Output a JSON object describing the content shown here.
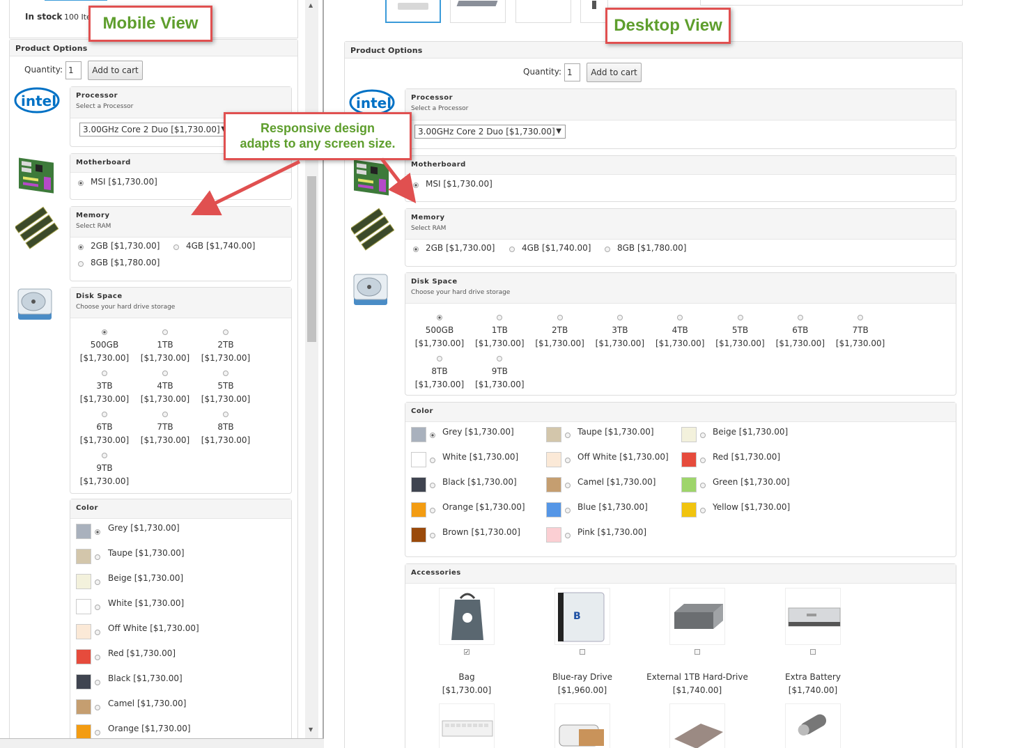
{
  "mobile": {
    "stock_label": "In stock",
    "stock_value": "100 Ite",
    "panel_title": "Product Options",
    "quantity_label": "Quantity:",
    "quantity_value": "1",
    "add_to_cart": "Add to cart",
    "processor": {
      "title": "Processor",
      "subtitle": "Select a Processor",
      "selected": "3.00GHz Core 2 Duo  [$1,730.00]"
    },
    "motherboard": {
      "title": "Motherboard",
      "option": "MSI  [$1,730.00]"
    },
    "memory": {
      "title": "Memory",
      "subtitle": "Select RAM",
      "options": [
        "2GB  [$1,730.00]",
        "4GB  [$1,740.00]",
        "8GB  [$1,780.00]"
      ]
    },
    "disk": {
      "title": "Disk Space",
      "subtitle": "Choose your hard drive storage",
      "options": [
        {
          "size": "500GB",
          "price": "[$1,730.00]"
        },
        {
          "size": "1TB",
          "price": "[$1,730.00]"
        },
        {
          "size": "2TB",
          "price": "[$1,730.00]"
        },
        {
          "size": "3TB",
          "price": "[$1,730.00]"
        },
        {
          "size": "4TB",
          "price": "[$1,730.00]"
        },
        {
          "size": "5TB",
          "price": "[$1,730.00]"
        },
        {
          "size": "6TB",
          "price": "[$1,730.00]"
        },
        {
          "size": "7TB",
          "price": "[$1,730.00]"
        },
        {
          "size": "8TB",
          "price": "[$1,730.00]"
        },
        {
          "size": "9TB",
          "price": "[$1,730.00]"
        }
      ]
    },
    "color": {
      "title": "Color",
      "options": [
        {
          "label": "Grey  [$1,730.00]",
          "hex": "#a9b1bd"
        },
        {
          "label": "Taupe  [$1,730.00]",
          "hex": "#d3c6ab"
        },
        {
          "label": "Beige  [$1,730.00]",
          "hex": "#f3f1dc"
        },
        {
          "label": "White  [$1,730.00]",
          "hex": "#ffffff"
        },
        {
          "label": "Off White  [$1,730.00]",
          "hex": "#fbe9d7"
        },
        {
          "label": "Red  [$1,730.00]",
          "hex": "#e64b3c"
        },
        {
          "label": "Black  [$1,730.00]",
          "hex": "#3f4450"
        },
        {
          "label": "Camel  [$1,730.00]",
          "hex": "#c59e70"
        },
        {
          "label": "Orange  [$1,730.00]",
          "hex": "#f39c12"
        }
      ]
    }
  },
  "desktop": {
    "panel_title": "Product Options",
    "quantity_label": "Quantity:",
    "quantity_value": "1",
    "add_to_cart": "Add to cart",
    "processor": {
      "title": "Processor",
      "subtitle": "Select a Processor",
      "selected": "3.00GHz Core 2 Duo  [$1,730.00]"
    },
    "motherboard": {
      "title": "Motherboard",
      "option": "MSI  [$1,730.00]"
    },
    "memory": {
      "title": "Memory",
      "subtitle": "Select RAM",
      "options": [
        "2GB  [$1,730.00]",
        "4GB  [$1,740.00]",
        "8GB  [$1,780.00]"
      ]
    },
    "disk": {
      "title": "Disk Space",
      "subtitle": "Choose your hard drive storage"
    },
    "color": {
      "title": "Color",
      "options": [
        {
          "label": "Grey  [$1,730.00]",
          "hex": "#a9b1bd"
        },
        {
          "label": "Taupe  [$1,730.00]",
          "hex": "#d3c6ab"
        },
        {
          "label": "Beige  [$1,730.00]",
          "hex": "#f3f1dc"
        },
        {
          "label": "White  [$1,730.00]",
          "hex": "#ffffff"
        },
        {
          "label": "Off White  [$1,730.00]",
          "hex": "#fbe9d7"
        },
        {
          "label": "Red  [$1,730.00]",
          "hex": "#e64b3c"
        },
        {
          "label": "Black  [$1,730.00]",
          "hex": "#3f4450"
        },
        {
          "label": "Camel  [$1,730.00]",
          "hex": "#c59e70"
        },
        {
          "label": "Green  [$1,730.00]",
          "hex": "#9ed56b"
        },
        {
          "label": "Orange  [$1,730.00]",
          "hex": "#f39c12"
        },
        {
          "label": "Blue  [$1,730.00]",
          "hex": "#5596e6"
        },
        {
          "label": "Yellow  [$1,730.00]",
          "hex": "#f1c40f"
        },
        {
          "label": "Brown  [$1,730.00]",
          "hex": "#9a4a0b"
        },
        {
          "label": "Pink  [$1,730.00]",
          "hex": "#fbcfd3"
        }
      ]
    },
    "accessories": {
      "title": "Accessories",
      "items": [
        {
          "name": "Bag",
          "price": "[$1,730.00]",
          "checked": true
        },
        {
          "name": "Blue-ray Drive",
          "price": "[$1,960.00]",
          "checked": false
        },
        {
          "name": "External 1TB Hard-Drive",
          "price": "[$1,740.00]",
          "checked": false
        },
        {
          "name": "Extra Battery",
          "price": "[$1,740.00]",
          "checked": false
        }
      ]
    }
  },
  "callouts": {
    "mobile": "Mobile View",
    "desktop": "Desktop View",
    "responsive_line1": "Responsive design",
    "responsive_line2": "adapts to any screen size."
  },
  "accent": {
    "callout_border": "#e05050",
    "callout_text": "#5e9e2d"
  }
}
